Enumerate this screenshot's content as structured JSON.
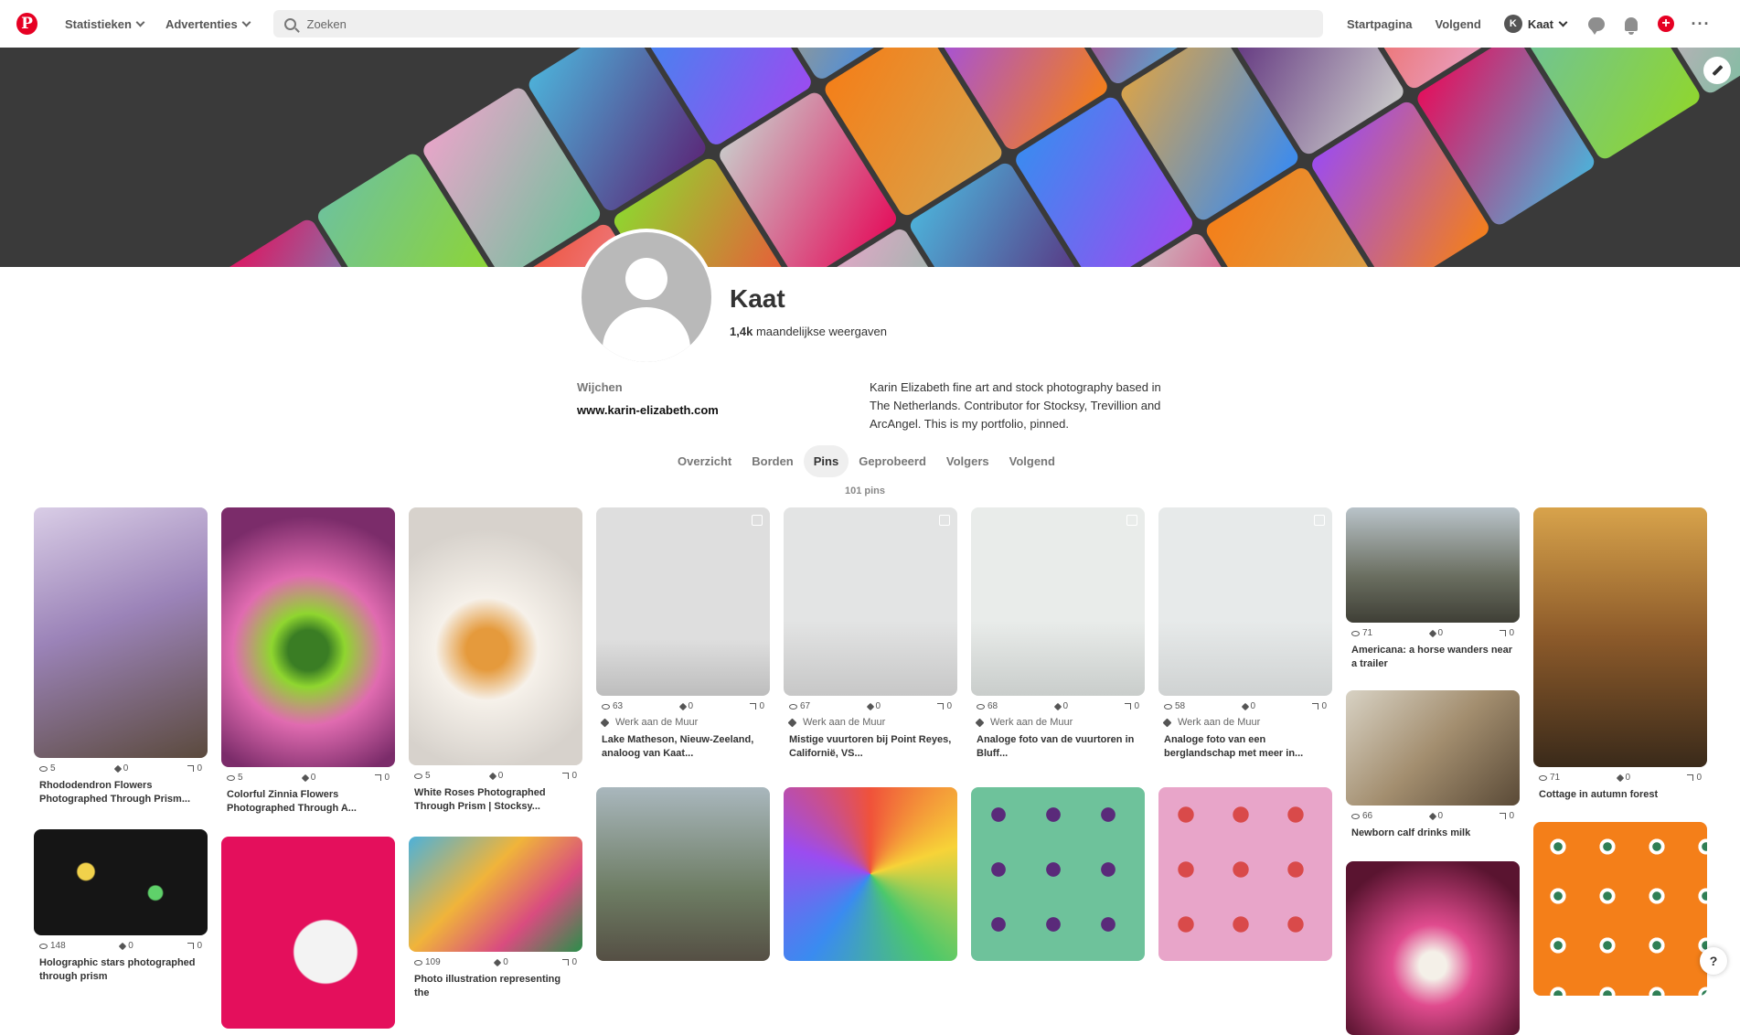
{
  "topbar": {
    "logo": "P",
    "nav": [
      "Statistieken",
      "Advertenties"
    ],
    "search_placeholder": "Zoeken",
    "links": [
      "Startpagina",
      "Volgend"
    ],
    "user_initial": "K",
    "user_name": "Kaat",
    "accent": "#e60023"
  },
  "profile": {
    "name": "Kaat",
    "views_value": "1,4k",
    "views_label": "maandelijkse weergaven",
    "location": "Wijchen",
    "website": "www.karin-elizabeth.com",
    "bio": "Karin Elizabeth fine art and stock photography based in The Netherlands. Contributor for Stocksy, Trevillion and ArcAngel. This is my portfolio, pinned."
  },
  "tabs": [
    {
      "label": "Overzicht",
      "active": false
    },
    {
      "label": "Borden",
      "active": false
    },
    {
      "label": "Pins",
      "active": true
    },
    {
      "label": "Geprobeerd",
      "active": false
    },
    {
      "label": "Volgers",
      "active": false
    },
    {
      "label": "Volgend",
      "active": false
    }
  ],
  "pin_count": "101 pins",
  "pins": [
    {
      "views": "5",
      "saves": "0",
      "clicks": "0",
      "source": "",
      "title": "Rhododendron Flowers Photographed Through Prism..."
    },
    {
      "views": "148",
      "saves": "0",
      "clicks": "0",
      "source": "",
      "title": "Holographic stars photographed through prism"
    },
    {
      "views": "5",
      "saves": "0",
      "clicks": "0",
      "source": "",
      "title": "Colorful Zinnia Flowers Photographed Through A..."
    },
    {
      "views": "",
      "saves": "",
      "clicks": "",
      "source": "",
      "title": ""
    },
    {
      "views": "5",
      "saves": "0",
      "clicks": "0",
      "source": "",
      "title": "White Roses Photographed Through Prism | Stocksy..."
    },
    {
      "views": "109",
      "saves": "0",
      "clicks": "0",
      "source": "",
      "title": "Photo illustration representing the"
    },
    {
      "views": "63",
      "saves": "0",
      "clicks": "0",
      "source": "Werk aan de Muur",
      "title": "Lake Matheson, Nieuw-Zeeland, analoog van Kaat..."
    },
    {
      "views": "",
      "saves": "",
      "clicks": "",
      "source": "",
      "title": ""
    },
    {
      "views": "67",
      "saves": "0",
      "clicks": "0",
      "source": "Werk aan de Muur",
      "title": "Mistige vuurtoren bij Point Reyes, Californië, VS..."
    },
    {
      "views": "",
      "saves": "",
      "clicks": "",
      "source": "",
      "title": ""
    },
    {
      "views": "68",
      "saves": "0",
      "clicks": "0",
      "source": "Werk aan de Muur",
      "title": "Analoge foto van de vuurtoren in Bluff..."
    },
    {
      "views": "",
      "saves": "",
      "clicks": "",
      "source": "",
      "title": ""
    },
    {
      "views": "58",
      "saves": "0",
      "clicks": "0",
      "source": "Werk aan de Muur",
      "title": "Analoge foto van een berglandschap met meer in..."
    },
    {
      "views": "",
      "saves": "",
      "clicks": "",
      "source": "",
      "title": ""
    },
    {
      "views": "71",
      "saves": "0",
      "clicks": "0",
      "source": "",
      "title": "Americana: a horse wanders near a trailer"
    },
    {
      "views": "66",
      "saves": "0",
      "clicks": "0",
      "source": "",
      "title": "Newborn calf drinks milk"
    },
    {
      "views": "",
      "saves": "",
      "clicks": "",
      "source": "",
      "title": ""
    },
    {
      "views": "71",
      "saves": "0",
      "clicks": "0",
      "source": "",
      "title": "Cottage in autumn forest"
    },
    {
      "views": "",
      "saves": "",
      "clicks": "",
      "source": "",
      "title": ""
    }
  ],
  "help_label": "?"
}
